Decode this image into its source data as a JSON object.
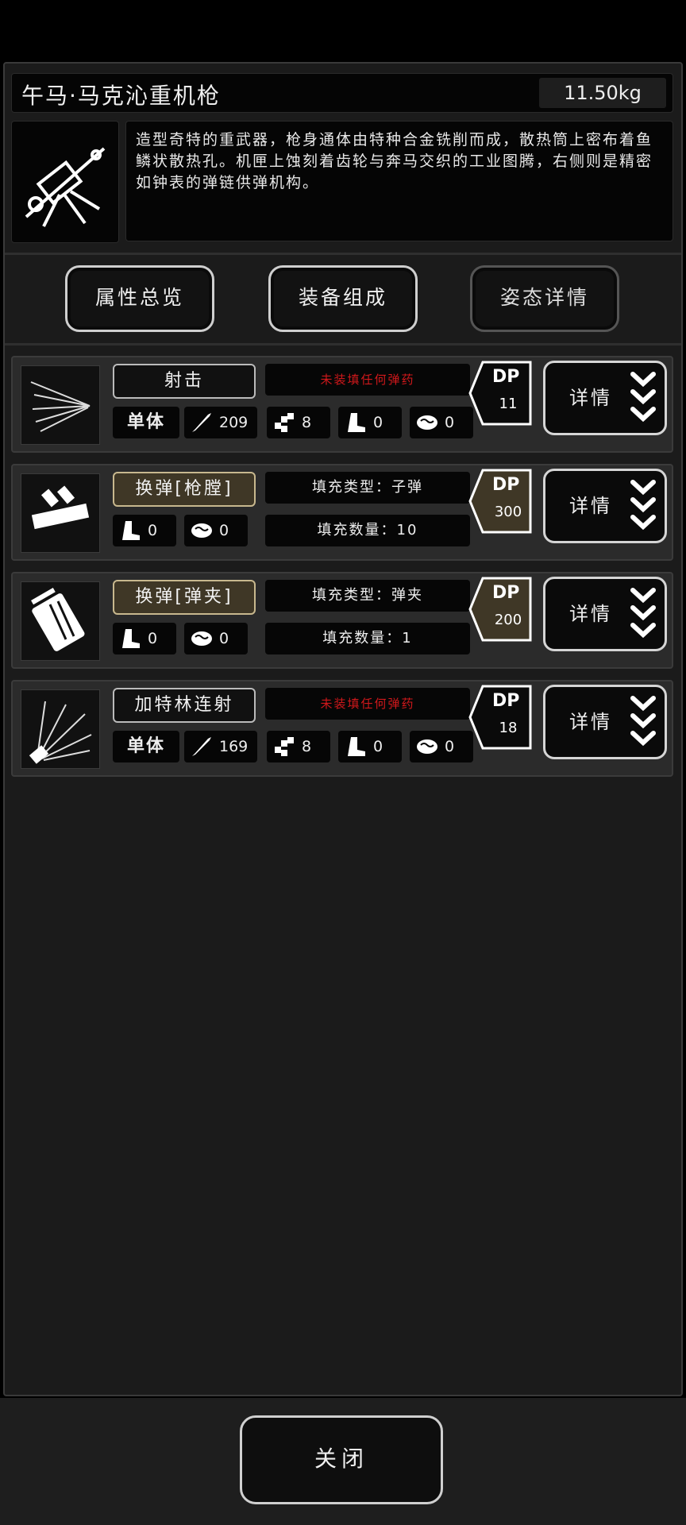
{
  "item": {
    "name": "午马·马克沁重机枪",
    "weight": "11.50kg",
    "description": "造型奇特的重武器，枪身通体由特种合金铣削而成，散热筒上密布着鱼鳞状散热孔。机匣上蚀刻着齿轮与奔马交织的工业图腾，右侧则是精密如钟表的弹链供弹机构。"
  },
  "tabs": [
    {
      "label": "属性总览"
    },
    {
      "label": "装备组成"
    },
    {
      "label": "姿态详情"
    }
  ],
  "rows": [
    {
      "name": "射击",
      "info1": "未装填任何弹药",
      "dp_label": "DP",
      "dp": "11",
      "target": "单体",
      "attack": "209",
      "stat2": "8",
      "stat3": "0",
      "stat4": "0",
      "detail": "详情"
    },
    {
      "name": "换弹[枪膛]",
      "info1": "填充类型：子弹",
      "info2": "填充数量：10",
      "dp_label": "DP",
      "dp": "300",
      "stat3": "0",
      "stat4": "0",
      "detail": "详情"
    },
    {
      "name": "换弹[弹夹]",
      "info1": "填充类型：弹夹",
      "info2": "填充数量：1",
      "dp_label": "DP",
      "dp": "200",
      "stat3": "0",
      "stat4": "0",
      "detail": "详情"
    },
    {
      "name": "加特林连射",
      "info1": "未装填任何弹药",
      "dp_label": "DP",
      "dp": "18",
      "target": "单体",
      "attack": "169",
      "stat2": "8",
      "stat3": "0",
      "stat4": "0",
      "detail": "详情"
    }
  ],
  "footer": {
    "close_label": "关闭"
  },
  "icons": {
    "attack": "sword-icon",
    "stat2": "checker-icon",
    "stat3": "boot-icon",
    "stat4": "brain-icon",
    "detail": "chevron-down-triple-icon"
  },
  "colors": {
    "warning_red": "#d0181b",
    "gold_tag": "#3f3726"
  }
}
